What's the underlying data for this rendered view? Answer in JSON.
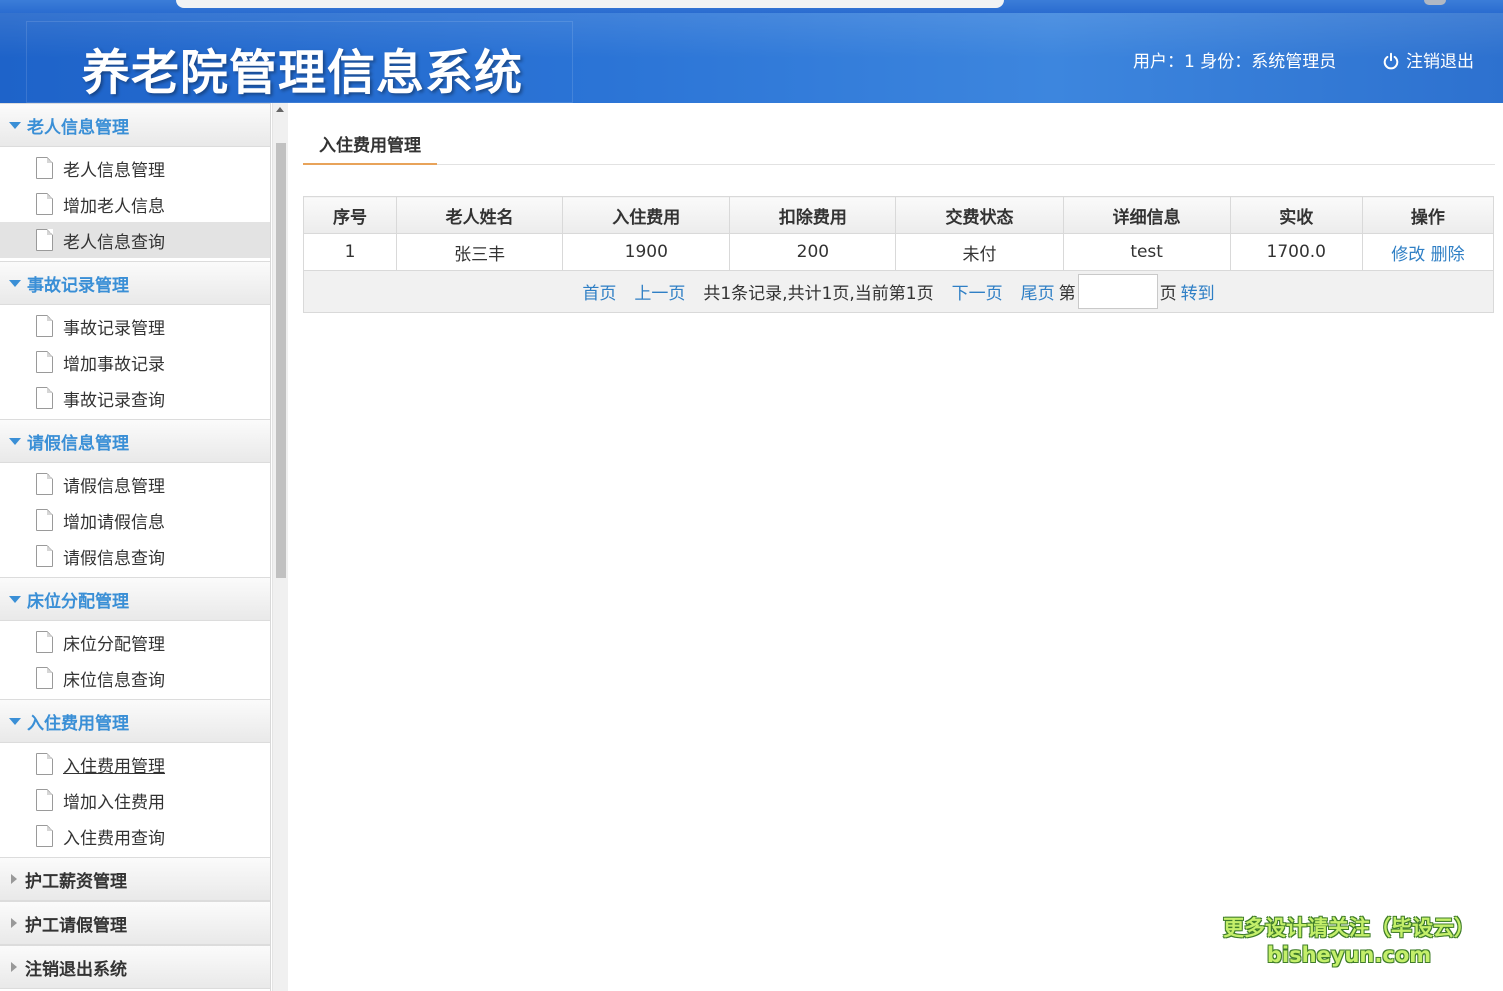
{
  "header": {
    "app_title": "养老院管理信息系统",
    "user_info": "用户：1 身份：系统管理员",
    "logout_label": "注销退出"
  },
  "sidebar": {
    "groups": [
      {
        "label": "老人信息管理",
        "expanded": true,
        "items": [
          {
            "label": "老人信息管理"
          },
          {
            "label": "增加老人信息"
          },
          {
            "label": "老人信息查询"
          }
        ]
      },
      {
        "label": "事故记录管理",
        "expanded": true,
        "items": [
          {
            "label": "事故记录管理"
          },
          {
            "label": "增加事故记录"
          },
          {
            "label": "事故记录查询"
          }
        ]
      },
      {
        "label": "请假信息管理",
        "expanded": true,
        "items": [
          {
            "label": "请假信息管理"
          },
          {
            "label": "增加请假信息"
          },
          {
            "label": "请假信息查询"
          }
        ]
      },
      {
        "label": "床位分配管理",
        "expanded": true,
        "items": [
          {
            "label": "床位分配管理"
          },
          {
            "label": "床位信息查询"
          }
        ]
      },
      {
        "label": "入住费用管理",
        "expanded": true,
        "items": [
          {
            "label": "入住费用管理"
          },
          {
            "label": "增加入住费用"
          },
          {
            "label": "入住费用查询"
          }
        ]
      },
      {
        "label": "护工薪资管理",
        "expanded": false,
        "items": []
      },
      {
        "label": "护工请假管理",
        "expanded": false,
        "items": []
      },
      {
        "label": "注销退出系统",
        "expanded": false,
        "items": []
      }
    ]
  },
  "main": {
    "tab_label": "入住费用管理",
    "table": {
      "columns": [
        "序号",
        "老人姓名",
        "入住费用",
        "扣除费用",
        "交费状态",
        "详细信息",
        "实收",
        "操作"
      ],
      "rows": [
        {
          "seq": "1",
          "name": "张三丰",
          "fee": "1900",
          "deduction": "200",
          "status": "未付",
          "detail": "test",
          "received": "1700.0",
          "edit": "修改",
          "delete": "删除"
        }
      ]
    },
    "pager": {
      "first": "首页",
      "prev": "上一页",
      "summary": "共1条记录,共计1页,当前第1页",
      "next": "下一页",
      "last": "尾页",
      "page_prefix": "第",
      "page_input_value": "",
      "page_suffix": "页",
      "go": "转到"
    }
  },
  "watermark": {
    "line1": "更多设计请关注（毕设云）",
    "line2": "bisheyun.com"
  }
}
